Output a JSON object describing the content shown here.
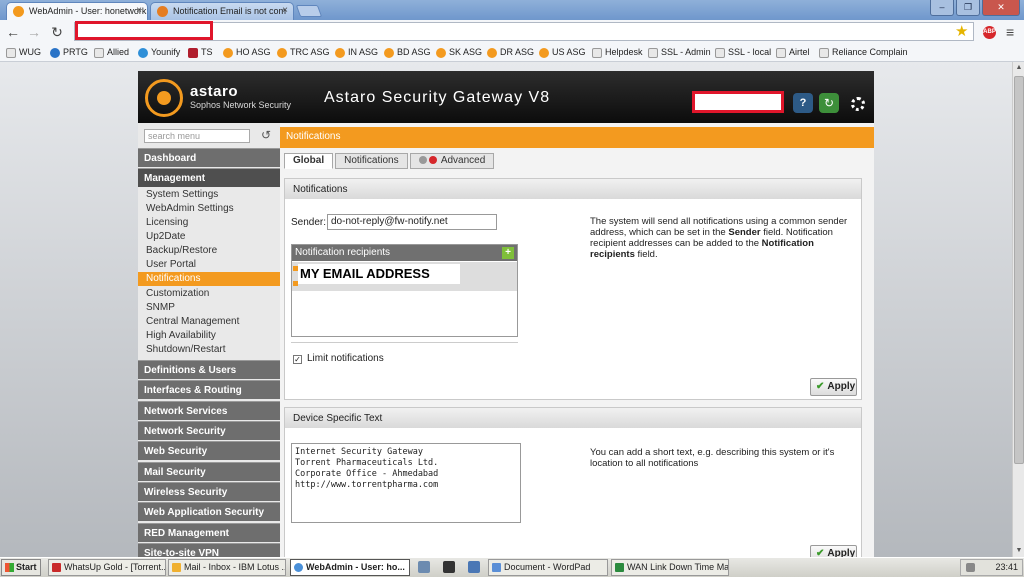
{
  "browser": {
    "tabs": [
      {
        "title": "WebAdmin - User: honetwork"
      },
      {
        "title": "Notification Email is not com"
      }
    ],
    "bookmarks": [
      "WUG",
      "PRTG",
      "Allied",
      "Younify",
      "TS",
      "HO ASG",
      "TRC ASG",
      "IN ASG",
      "BD ASG",
      "SK ASG",
      "DR ASG",
      "US ASG",
      "Helpdesk",
      "SSL - Admin",
      "SSL - local",
      "Airtel",
      "Reliance Complain"
    ]
  },
  "header": {
    "logo_name": "astaro",
    "logo_sub": "Sophos Network Security",
    "product": "Astaro Security Gateway V8"
  },
  "sidebar": {
    "search_placeholder": "search menu",
    "sections": {
      "dashboard": "Dashboard",
      "management": "Management",
      "definitions": "Definitions & Users",
      "interfaces": "Interfaces & Routing",
      "network_services": "Network Services",
      "network_security": "Network Security",
      "web_security": "Web Security",
      "mail_security": "Mail Security",
      "wireless_security": "Wireless Security",
      "web_app_security": "Web Application Security",
      "red": "RED Management",
      "s2s_vpn": "Site-to-site VPN"
    },
    "management_items": [
      "System Settings",
      "WebAdmin Settings",
      "Licensing",
      "Up2Date",
      "Backup/Restore",
      "User Portal",
      "Notifications",
      "Customization",
      "SNMP",
      "Central Management",
      "High Availability",
      "Shutdown/Restart"
    ]
  },
  "content": {
    "title": "Notifications",
    "tabs": {
      "global": "Global",
      "notifications": "Notifications",
      "advanced": "Advanced"
    },
    "notifications_panel": {
      "heading": "Notifications",
      "sender_label": "Sender:",
      "sender_value": "do-not-reply@fw-notify.net",
      "recipients_heading": "Notification recipients",
      "recipient_email": "MY EMAIL ADDRESS",
      "limit_label": "Limit notifications",
      "info_pre": "The system will send all notifications using a common sender address, which can be set in the ",
      "info_b1": "Sender",
      "info_mid": " field. Notification recipient addresses can be added to the ",
      "info_b2": "Notification recipients",
      "info_post": " field.",
      "apply": "Apply"
    },
    "device_panel": {
      "heading": "Device Specific Text",
      "text": "Internet Security Gateway\nTorrent Pharmaceuticals Ltd.\nCorporate Office - Ahmedabad\nhttp://www.torrentpharma.com",
      "info": "You can add a short text, e.g. describing this system or it's location to all notifications",
      "apply": "Apply"
    }
  },
  "taskbar": {
    "start": "Start",
    "items": [
      "WhatsUp Gold - [Torrent...",
      "Mail - Inbox - IBM Lotus ...",
      "WebAdmin - User: ho...",
      "Document - WordPad",
      "WAN Link Down Time Ma..."
    ],
    "clock": "23:41"
  },
  "colors": {
    "accent": "#f39a1f",
    "header": "#111111",
    "redaction": "#e0162b"
  }
}
